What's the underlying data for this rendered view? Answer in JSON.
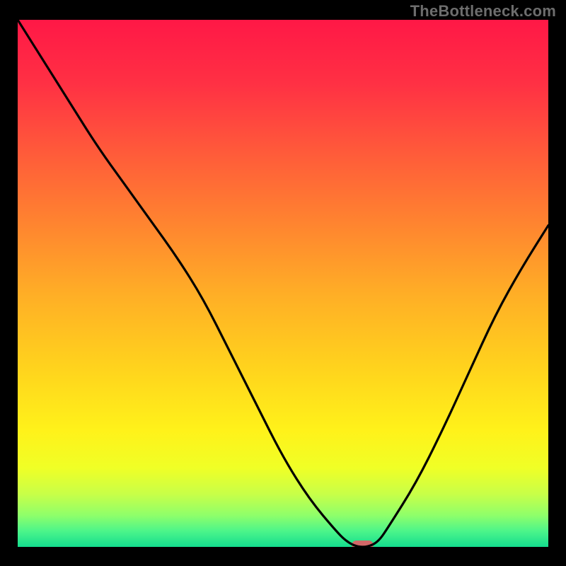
{
  "watermark": {
    "text": "TheBottleneck.com"
  },
  "chart_data": {
    "type": "line",
    "title": "",
    "xlabel": "",
    "ylabel": "",
    "xlim": [
      0,
      100
    ],
    "ylim": [
      0,
      100
    ],
    "grid": false,
    "legend": false,
    "x": [
      0,
      5,
      10,
      15,
      20,
      25,
      30,
      35,
      40,
      45,
      50,
      55,
      60,
      62,
      64,
      66,
      68,
      70,
      75,
      80,
      85,
      90,
      95,
      100
    ],
    "values": [
      100,
      92,
      84,
      76,
      69,
      62,
      55,
      47,
      37,
      27,
      17,
      9,
      3,
      1,
      0,
      0,
      1,
      4,
      12,
      22,
      33,
      44,
      53,
      61
    ],
    "marker": {
      "x": 65,
      "y": 0,
      "color": "#d26868",
      "width_frac": 0.04
    },
    "background_gradient": {
      "stops": [
        {
          "offset": 0.0,
          "color": "#ff1846"
        },
        {
          "offset": 0.12,
          "color": "#ff3044"
        },
        {
          "offset": 0.25,
          "color": "#ff5a3a"
        },
        {
          "offset": 0.38,
          "color": "#ff8230"
        },
        {
          "offset": 0.52,
          "color": "#ffae26"
        },
        {
          "offset": 0.66,
          "color": "#ffd31d"
        },
        {
          "offset": 0.78,
          "color": "#fff21a"
        },
        {
          "offset": 0.85,
          "color": "#f0ff26"
        },
        {
          "offset": 0.9,
          "color": "#c8ff48"
        },
        {
          "offset": 0.94,
          "color": "#8fff6a"
        },
        {
          "offset": 0.97,
          "color": "#4cf58a"
        },
        {
          "offset": 1.0,
          "color": "#14dd8e"
        }
      ]
    }
  }
}
